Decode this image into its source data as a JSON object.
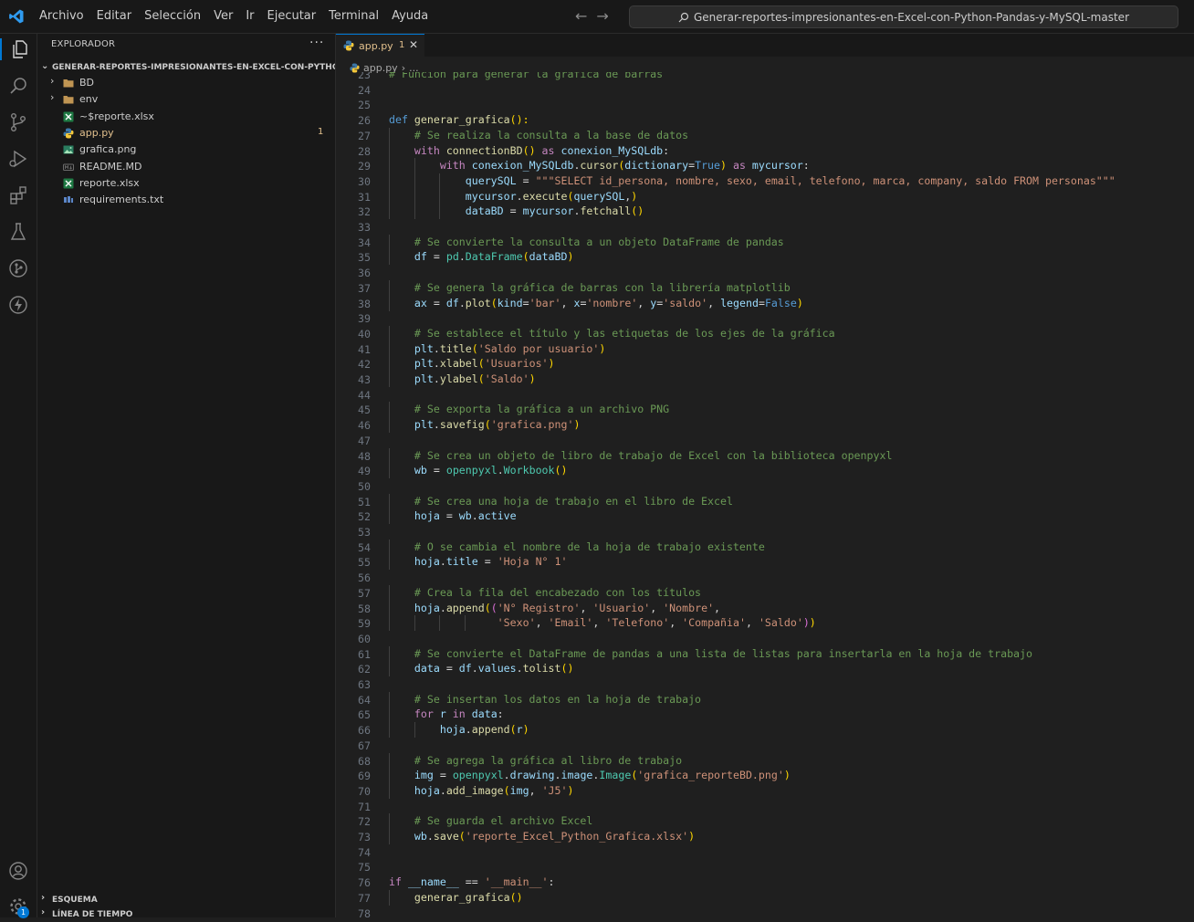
{
  "menu": [
    "Archivo",
    "Editar",
    "Selección",
    "Ver",
    "Ir",
    "Ejecutar",
    "Terminal",
    "Ayuda"
  ],
  "command_center": "Generar-reportes-impresionantes-en-Excel-con-Python-Pandas-y-MySQL-master",
  "sidebar": {
    "title": "EXPLORADOR",
    "folder": "GENERAR-REPORTES-IMPRESIONANTES-EN-EXCEL-CON-PYTHON-PA...",
    "items": [
      {
        "name": "BD",
        "type": "folder"
      },
      {
        "name": "env",
        "type": "folder"
      },
      {
        "name": "~$reporte.xlsx",
        "type": "excel"
      },
      {
        "name": "app.py",
        "type": "python",
        "badge": "1"
      },
      {
        "name": "grafica.png",
        "type": "image"
      },
      {
        "name": "README.MD",
        "type": "markdown"
      },
      {
        "name": "reporte.xlsx",
        "type": "excel"
      },
      {
        "name": "requirements.txt",
        "type": "text"
      }
    ],
    "outline": "ESQUEMA",
    "timeline": "LÍNEA DE TIEMPO"
  },
  "activity_badge": "1",
  "tab": {
    "label": "app.py",
    "badge": "1"
  },
  "breadcrumb": {
    "file": "app.py",
    "rest": "..."
  },
  "colors": {
    "accent": "#0078d4",
    "modified": "#e2c08d",
    "background": "#1f1f1f"
  },
  "code_lines": [
    {
      "n": "23",
      "segs": [
        [
          "cm",
          "# Función para generar la gráfica de barras"
        ]
      ]
    },
    {
      "n": "24",
      "segs": []
    },
    {
      "n": "25",
      "segs": []
    },
    {
      "n": "26",
      "segs": [
        [
          "kw",
          "def "
        ],
        [
          "fn",
          "generar_grafica"
        ],
        [
          "br1",
          "():"
        ]
      ]
    },
    {
      "n": "27",
      "segs": [
        [
          "",
          "    "
        ],
        [
          "cm",
          "# Se realiza la consulta a la base de datos"
        ]
      ]
    },
    {
      "n": "28",
      "segs": [
        [
          "",
          "    "
        ],
        [
          "ctl",
          "with "
        ],
        [
          "fn",
          "connectionBD"
        ],
        [
          "br1",
          "()"
        ],
        [
          "ctl",
          " as "
        ],
        [
          "var",
          "conexion_MySQLdb"
        ],
        [
          "",
          ":"
        ]
      ]
    },
    {
      "n": "29",
      "segs": [
        [
          "",
          "        "
        ],
        [
          "ctl",
          "with "
        ],
        [
          "var",
          "conexion_MySQLdb"
        ],
        [
          "",
          "."
        ],
        [
          "fn",
          "cursor"
        ],
        [
          "br1",
          "("
        ],
        [
          "var",
          "dictionary"
        ],
        [
          "",
          "="
        ],
        [
          "const",
          "True"
        ],
        [
          "br1",
          ")"
        ],
        [
          "ctl",
          " as "
        ],
        [
          "var",
          "mycursor"
        ],
        [
          "",
          ":"
        ]
      ]
    },
    {
      "n": "30",
      "segs": [
        [
          "",
          "            "
        ],
        [
          "var",
          "querySQL"
        ],
        [
          "",
          " = "
        ],
        [
          "str",
          "\"\"\"SELECT id_persona, nombre, sexo, email, telefono, marca, company, saldo FROM personas\"\"\""
        ]
      ]
    },
    {
      "n": "31",
      "segs": [
        [
          "",
          "            "
        ],
        [
          "var",
          "mycursor"
        ],
        [
          "",
          "."
        ],
        [
          "fn",
          "execute"
        ],
        [
          "br1",
          "("
        ],
        [
          "var",
          "querySQL"
        ],
        [
          "",
          ","
        ],
        [
          "br1",
          ")"
        ]
      ]
    },
    {
      "n": "32",
      "segs": [
        [
          "",
          "            "
        ],
        [
          "var",
          "dataBD"
        ],
        [
          "",
          " = "
        ],
        [
          "var",
          "mycursor"
        ],
        [
          "",
          "."
        ],
        [
          "fn",
          "fetchall"
        ],
        [
          "br1",
          "()"
        ]
      ]
    },
    {
      "n": "33",
      "segs": []
    },
    {
      "n": "34",
      "segs": [
        [
          "",
          "    "
        ],
        [
          "cm",
          "# Se convierte la consulta a un objeto DataFrame de pandas"
        ]
      ]
    },
    {
      "n": "35",
      "segs": [
        [
          "",
          "    "
        ],
        [
          "var",
          "df"
        ],
        [
          "",
          " = "
        ],
        [
          "cls",
          "pd"
        ],
        [
          "",
          "."
        ],
        [
          "cls",
          "DataFrame"
        ],
        [
          "br1",
          "("
        ],
        [
          "var",
          "dataBD"
        ],
        [
          "br1",
          ")"
        ]
      ]
    },
    {
      "n": "36",
      "segs": []
    },
    {
      "n": "37",
      "segs": [
        [
          "",
          "    "
        ],
        [
          "cm",
          "# Se genera la gráfica de barras con la librería matplotlib"
        ]
      ]
    },
    {
      "n": "38",
      "segs": [
        [
          "",
          "    "
        ],
        [
          "var",
          "ax"
        ],
        [
          "",
          " = "
        ],
        [
          "var",
          "df"
        ],
        [
          "",
          "."
        ],
        [
          "fn",
          "plot"
        ],
        [
          "br1",
          "("
        ],
        [
          "var",
          "kind"
        ],
        [
          "",
          "="
        ],
        [
          "str",
          "'bar'"
        ],
        [
          "",
          ", "
        ],
        [
          "var",
          "x"
        ],
        [
          "",
          "="
        ],
        [
          "str",
          "'nombre'"
        ],
        [
          "",
          ", "
        ],
        [
          "var",
          "y"
        ],
        [
          "",
          "="
        ],
        [
          "str",
          "'saldo'"
        ],
        [
          "",
          ", "
        ],
        [
          "var",
          "legend"
        ],
        [
          "",
          "="
        ],
        [
          "const",
          "False"
        ],
        [
          "br1",
          ")"
        ]
      ]
    },
    {
      "n": "39",
      "segs": []
    },
    {
      "n": "40",
      "segs": [
        [
          "",
          "    "
        ],
        [
          "cm",
          "# Se establece el título y las etiquetas de los ejes de la gráfica"
        ]
      ]
    },
    {
      "n": "41",
      "segs": [
        [
          "",
          "    "
        ],
        [
          "var",
          "plt"
        ],
        [
          "",
          "."
        ],
        [
          "fn",
          "title"
        ],
        [
          "br1",
          "("
        ],
        [
          "str",
          "'Saldo por usuario'"
        ],
        [
          "br1",
          ")"
        ]
      ]
    },
    {
      "n": "42",
      "segs": [
        [
          "",
          "    "
        ],
        [
          "var",
          "plt"
        ],
        [
          "",
          "."
        ],
        [
          "fn",
          "xlabel"
        ],
        [
          "br1",
          "("
        ],
        [
          "str",
          "'Usuarios'"
        ],
        [
          "br1",
          ")"
        ]
      ]
    },
    {
      "n": "43",
      "segs": [
        [
          "",
          "    "
        ],
        [
          "var",
          "plt"
        ],
        [
          "",
          "."
        ],
        [
          "fn",
          "ylabel"
        ],
        [
          "br1",
          "("
        ],
        [
          "str",
          "'Saldo'"
        ],
        [
          "br1",
          ")"
        ]
      ]
    },
    {
      "n": "44",
      "segs": []
    },
    {
      "n": "45",
      "segs": [
        [
          "",
          "    "
        ],
        [
          "cm",
          "# Se exporta la gráfica a un archivo PNG"
        ]
      ]
    },
    {
      "n": "46",
      "segs": [
        [
          "",
          "    "
        ],
        [
          "var",
          "plt"
        ],
        [
          "",
          "."
        ],
        [
          "fn",
          "savefig"
        ],
        [
          "br1",
          "("
        ],
        [
          "str",
          "'grafica.png'"
        ],
        [
          "br1",
          ")"
        ]
      ]
    },
    {
      "n": "47",
      "segs": []
    },
    {
      "n": "48",
      "segs": [
        [
          "",
          "    "
        ],
        [
          "cm",
          "# Se crea un objeto de libro de trabajo de Excel con la biblioteca openpyxl"
        ]
      ]
    },
    {
      "n": "49",
      "segs": [
        [
          "",
          "    "
        ],
        [
          "var",
          "wb"
        ],
        [
          "",
          " = "
        ],
        [
          "cls",
          "openpyxl"
        ],
        [
          "",
          "."
        ],
        [
          "cls",
          "Workbook"
        ],
        [
          "br1",
          "()"
        ]
      ]
    },
    {
      "n": "50",
      "segs": []
    },
    {
      "n": "51",
      "segs": [
        [
          "",
          "    "
        ],
        [
          "cm",
          "# Se crea una hoja de trabajo en el libro de Excel"
        ]
      ]
    },
    {
      "n": "52",
      "segs": [
        [
          "",
          "    "
        ],
        [
          "var",
          "hoja"
        ],
        [
          "",
          " = "
        ],
        [
          "var",
          "wb"
        ],
        [
          "",
          "."
        ],
        [
          "var",
          "active"
        ]
      ]
    },
    {
      "n": "53",
      "segs": []
    },
    {
      "n": "54",
      "segs": [
        [
          "",
          "    "
        ],
        [
          "cm",
          "# O se cambia el nombre de la hoja de trabajo existente"
        ]
      ]
    },
    {
      "n": "55",
      "segs": [
        [
          "",
          "    "
        ],
        [
          "var",
          "hoja"
        ],
        [
          "",
          "."
        ],
        [
          "var",
          "title"
        ],
        [
          "",
          " = "
        ],
        [
          "str",
          "'Hoja N° 1'"
        ]
      ]
    },
    {
      "n": "56",
      "segs": []
    },
    {
      "n": "57",
      "segs": [
        [
          "",
          "    "
        ],
        [
          "cm",
          "# Crea la fila del encabezado con los títulos"
        ]
      ]
    },
    {
      "n": "58",
      "segs": [
        [
          "",
          "    "
        ],
        [
          "var",
          "hoja"
        ],
        [
          "",
          "."
        ],
        [
          "fn",
          "append"
        ],
        [
          "br1",
          "("
        ],
        [
          "br2",
          "("
        ],
        [
          "str",
          "'N° Registro'"
        ],
        [
          "",
          ", "
        ],
        [
          "str",
          "'Usuario'"
        ],
        [
          "",
          ", "
        ],
        [
          "str",
          "'Nombre'"
        ],
        [
          "",
          ","
        ]
      ]
    },
    {
      "n": "59",
      "segs": [
        [
          "",
          "                 "
        ],
        [
          "str",
          "'Sexo'"
        ],
        [
          "",
          ", "
        ],
        [
          "str",
          "'Email'"
        ],
        [
          "",
          ", "
        ],
        [
          "str",
          "'Telefono'"
        ],
        [
          "",
          ", "
        ],
        [
          "str",
          "'Compañia'"
        ],
        [
          "",
          ", "
        ],
        [
          "str",
          "'Saldo'"
        ],
        [
          "br2",
          ")"
        ],
        [
          "br1",
          ")"
        ]
      ]
    },
    {
      "n": "60",
      "segs": []
    },
    {
      "n": "61",
      "segs": [
        [
          "",
          "    "
        ],
        [
          "cm",
          "# Se convierte el DataFrame de pandas a una lista de listas para insertarla en la hoja de trabajo"
        ]
      ]
    },
    {
      "n": "62",
      "segs": [
        [
          "",
          "    "
        ],
        [
          "var",
          "data"
        ],
        [
          "",
          " = "
        ],
        [
          "var",
          "df"
        ],
        [
          "",
          "."
        ],
        [
          "var",
          "values"
        ],
        [
          "",
          "."
        ],
        [
          "fn",
          "tolist"
        ],
        [
          "br1",
          "()"
        ]
      ]
    },
    {
      "n": "63",
      "segs": []
    },
    {
      "n": "64",
      "segs": [
        [
          "",
          "    "
        ],
        [
          "cm",
          "# Se insertan los datos en la hoja de trabajo"
        ]
      ]
    },
    {
      "n": "65",
      "segs": [
        [
          "",
          "    "
        ],
        [
          "ctl",
          "for "
        ],
        [
          "var",
          "r"
        ],
        [
          "ctl",
          " in "
        ],
        [
          "var",
          "data"
        ],
        [
          "",
          ":"
        ]
      ]
    },
    {
      "n": "66",
      "segs": [
        [
          "",
          "        "
        ],
        [
          "var",
          "hoja"
        ],
        [
          "",
          "."
        ],
        [
          "fn",
          "append"
        ],
        [
          "br1",
          "("
        ],
        [
          "var",
          "r"
        ],
        [
          "br1",
          ")"
        ]
      ]
    },
    {
      "n": "67",
      "segs": []
    },
    {
      "n": "68",
      "segs": [
        [
          "",
          "    "
        ],
        [
          "cm",
          "# Se agrega la gráfica al libro de trabajo"
        ]
      ]
    },
    {
      "n": "69",
      "segs": [
        [
          "",
          "    "
        ],
        [
          "var",
          "img"
        ],
        [
          "",
          " = "
        ],
        [
          "cls",
          "openpyxl"
        ],
        [
          "",
          "."
        ],
        [
          "var",
          "drawing"
        ],
        [
          "",
          "."
        ],
        [
          "var",
          "image"
        ],
        [
          "",
          "."
        ],
        [
          "cls",
          "Image"
        ],
        [
          "br1",
          "("
        ],
        [
          "str",
          "'grafica_reporteBD.png'"
        ],
        [
          "br1",
          ")"
        ]
      ]
    },
    {
      "n": "70",
      "segs": [
        [
          "",
          "    "
        ],
        [
          "var",
          "hoja"
        ],
        [
          "",
          "."
        ],
        [
          "fn",
          "add_image"
        ],
        [
          "br1",
          "("
        ],
        [
          "var",
          "img"
        ],
        [
          "",
          ", "
        ],
        [
          "str",
          "'J5'"
        ],
        [
          "br1",
          ")"
        ]
      ]
    },
    {
      "n": "71",
      "segs": []
    },
    {
      "n": "72",
      "segs": [
        [
          "",
          "    "
        ],
        [
          "cm",
          "# Se guarda el archivo Excel"
        ]
      ]
    },
    {
      "n": "73",
      "segs": [
        [
          "",
          "    "
        ],
        [
          "var",
          "wb"
        ],
        [
          "",
          "."
        ],
        [
          "fn",
          "save"
        ],
        [
          "br1",
          "("
        ],
        [
          "str",
          "'reporte_Excel_Python_Grafica.xlsx'"
        ],
        [
          "br1",
          ")"
        ]
      ]
    },
    {
      "n": "74",
      "segs": []
    },
    {
      "n": "75",
      "segs": []
    },
    {
      "n": "76",
      "segs": [
        [
          "ctl",
          "if "
        ],
        [
          "var",
          "__name__"
        ],
        [
          "",
          " == "
        ],
        [
          "str",
          "'__main__'"
        ],
        [
          "",
          ":"
        ]
      ]
    },
    {
      "n": "77",
      "segs": [
        [
          "",
          "    "
        ],
        [
          "fn",
          "generar_grafica"
        ],
        [
          "br1",
          "()"
        ]
      ]
    },
    {
      "n": "78",
      "segs": []
    }
  ]
}
